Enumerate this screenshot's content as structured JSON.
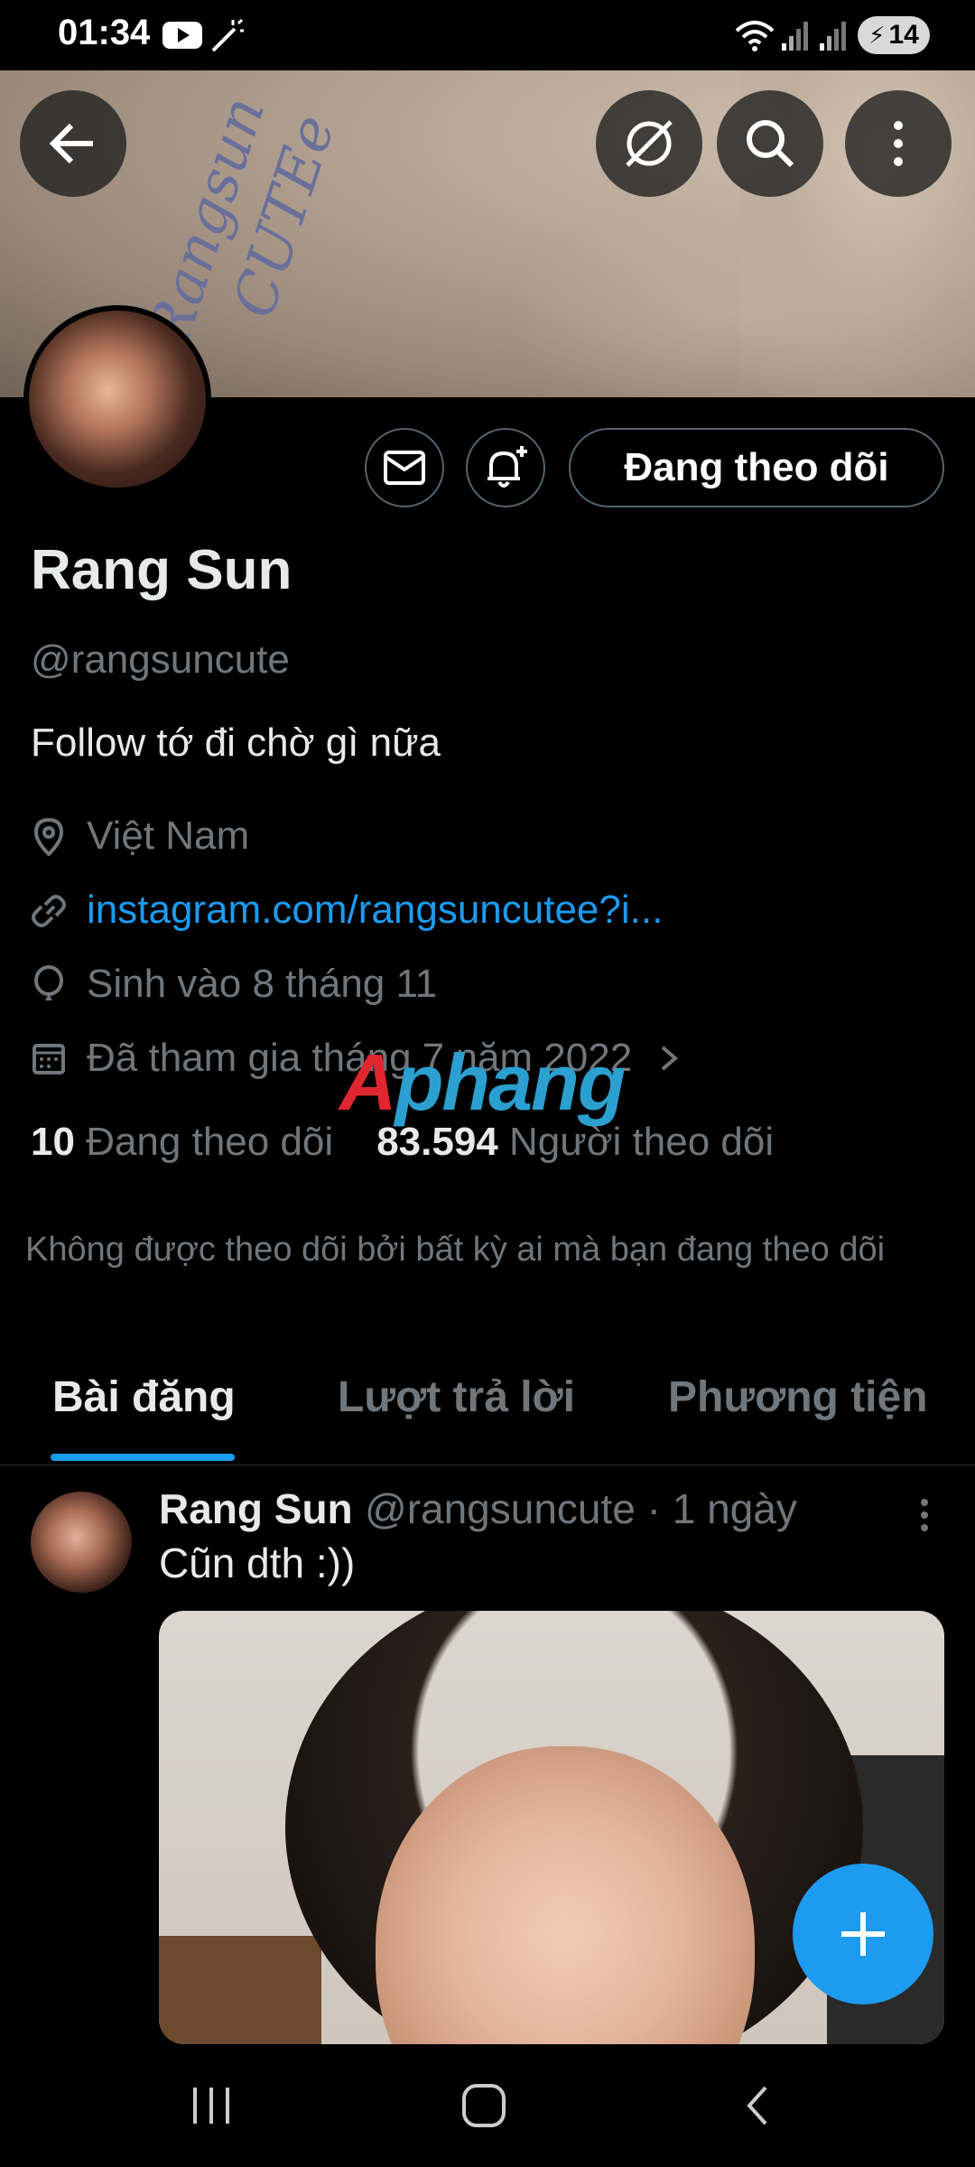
{
  "status_bar": {
    "time": "01:34",
    "battery": "14",
    "icons": [
      "youtube-icon",
      "magic-wand-icon",
      "wifi-icon",
      "signal-icon",
      "signal-icon",
      "battery-charging-icon"
    ]
  },
  "banner": {
    "handwriting_line1": "Rangsun",
    "handwriting_line2": "CUTEe"
  },
  "header_buttons": {
    "back": "back-arrow-icon",
    "mute": "slashed-circle-icon",
    "search": "search-icon",
    "more": "more-vertical-icon"
  },
  "profile": {
    "follow_state_label": "Đang theo dõi",
    "display_name": "Rang Sun",
    "handle": "@rangsuncute",
    "bio": "Follow tớ đi chờ gì nữa",
    "location": "Việt Nam",
    "link": "instagram.com/rangsuncutee?i...",
    "birthday": "Sinh vào 8 tháng 11",
    "joined": "Đã tham gia tháng 7 năm 2022",
    "following_count": "10",
    "following_label": "Đang theo dõi",
    "followers_count": "83.594",
    "followers_label": "Người theo dõi",
    "not_followed_note": "Không được theo dõi bởi bất kỳ ai mà bạn đang theo dõi"
  },
  "tabs": [
    {
      "label": "Bài đăng",
      "active": true
    },
    {
      "label": "Lượt trả lời",
      "active": false
    },
    {
      "label": "Phương tiện",
      "active": false
    }
  ],
  "post": {
    "author": "Rang Sun",
    "meta": "@rangsuncute · 1 ngày",
    "text": "Cũn dth :))"
  },
  "watermark": {
    "part1": "A",
    "part2": "phang"
  },
  "colors": {
    "accent": "#1d9bf0",
    "secondary_text": "#71767b",
    "border": "#536471"
  }
}
